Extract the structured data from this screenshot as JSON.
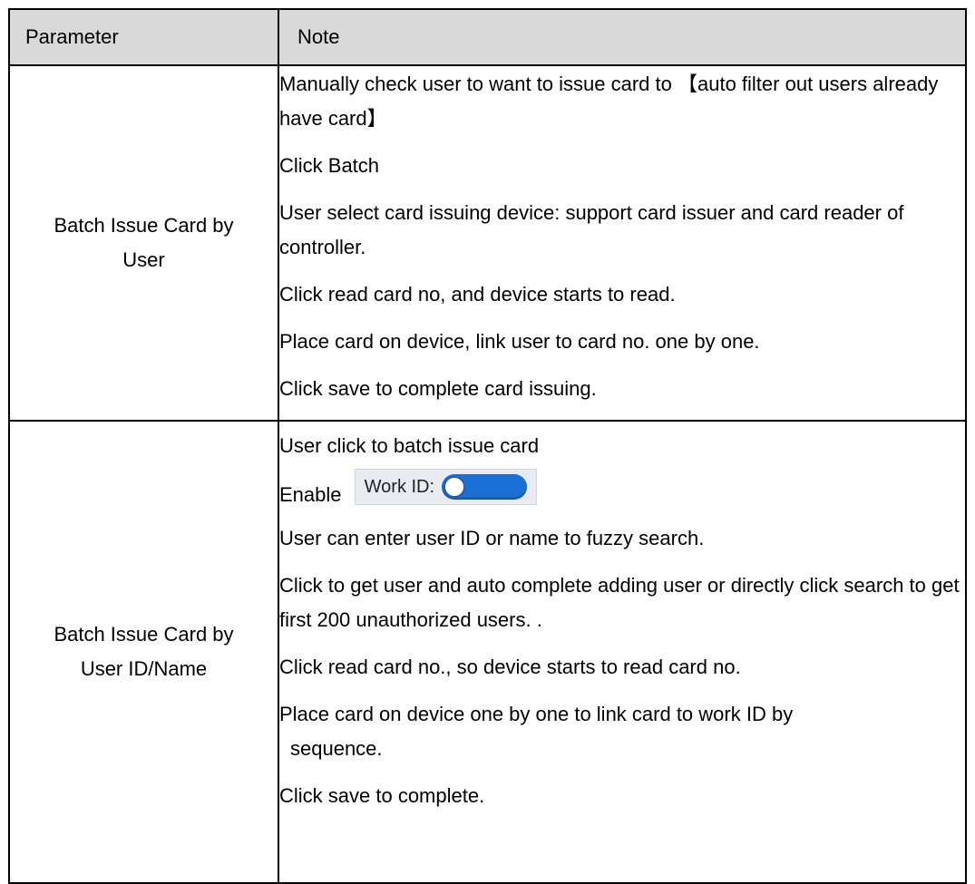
{
  "table": {
    "headers": [
      "Parameter",
      "Note"
    ],
    "rows": [
      {
        "parameter": "Batch Issue Card by\nUser",
        "parameter_lines": [
          "Batch Issue Card by",
          "User"
        ],
        "notes": [
          "Manually check user to want to issue card to 【auto filter out users already have card】",
          "Click Batch",
          "User select card issuing device: support card issuer and card reader of controller.",
          "Click read card no, and device starts to read.",
          "Place card on device, link user to card no. one by one.",
          "Click save to complete card issuing."
        ]
      },
      {
        "parameter_lines": [
          "Batch Issue Card by",
          "User ID/Name"
        ],
        "notes": [
          "User click to batch issue card",
          "Enable",
          "User can enter user ID or name to fuzzy search.",
          "Click to get user and auto complete adding user or directly click search to get first 200 unauthorized users. .",
          "Click read card no., so device starts to read card no.",
          "Place card on device one by one to link card to work ID by",
          "sequence.",
          "Click save to complete."
        ],
        "toggle": {
          "label": "Work ID:",
          "state": "on",
          "color": "#1c6fd4"
        }
      }
    ]
  }
}
